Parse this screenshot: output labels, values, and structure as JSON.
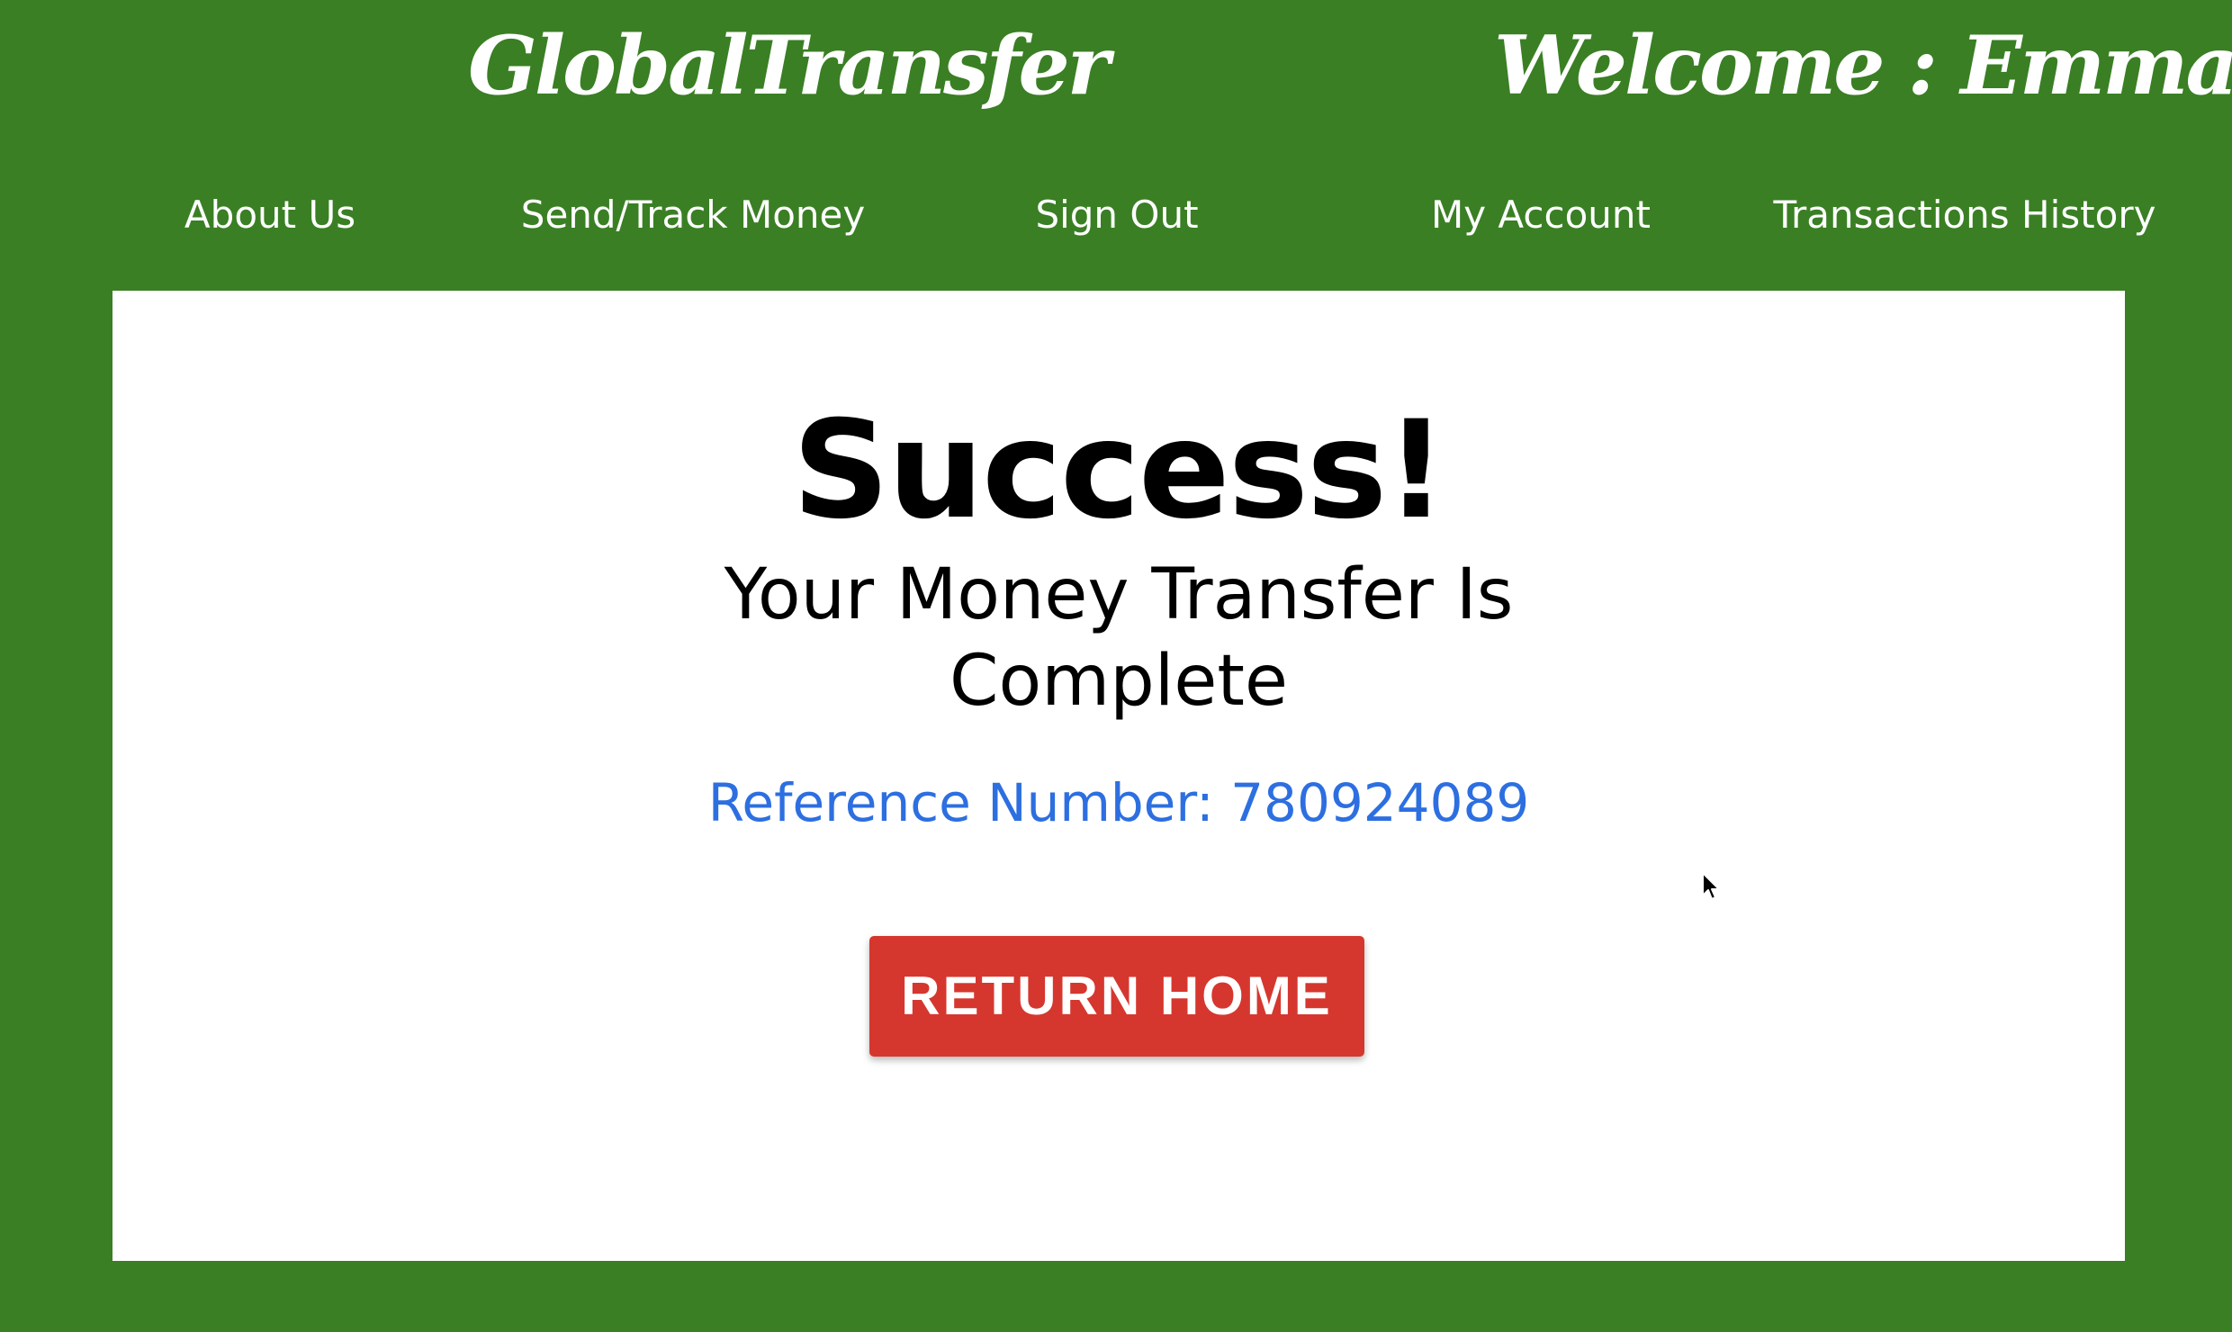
{
  "header": {
    "brand": "GlobalTransfer",
    "welcome": "Welcome : Emma"
  },
  "nav": {
    "items": [
      {
        "label": "About Us"
      },
      {
        "label": "Send/Track Money"
      },
      {
        "label": "Sign Out"
      },
      {
        "label": "My Account"
      },
      {
        "label": "Transactions History"
      }
    ]
  },
  "main": {
    "title": "Success!",
    "subtitle_line1": "Your Money Transfer Is",
    "subtitle_line2": "Complete",
    "reference": "Reference Number: 780924089",
    "button_label": "RETURN HOME"
  },
  "icons": {
    "cursor": "mouse-pointer-icon"
  },
  "colors": {
    "background": "#3a7f24",
    "card": "#ffffff",
    "reference": "#2d6fe0",
    "button": "#d5372f"
  }
}
